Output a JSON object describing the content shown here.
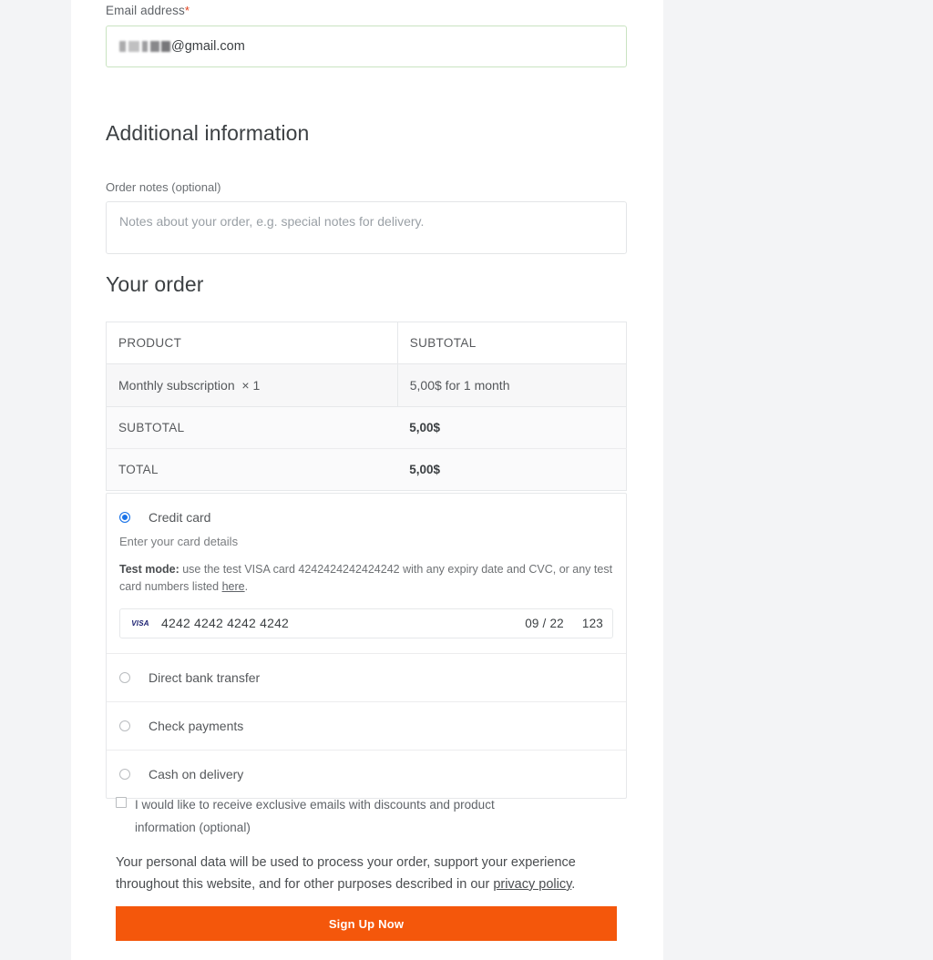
{
  "email_section": {
    "label": "Email address",
    "required_marker": "*",
    "value_redacted_suffix": "@gmail.com"
  },
  "additional_information": {
    "heading": "Additional information",
    "order_notes_label": "Order notes (optional)",
    "order_notes_placeholder": "Notes about your order, e.g. special notes for delivery.",
    "order_notes_value": ""
  },
  "your_order": {
    "heading": "Your order",
    "columns": [
      "PRODUCT",
      "SUBTOTAL"
    ],
    "rows": [
      {
        "product": "Monthly subscription",
        "qty": "× 1",
        "subtotal": "5,00$ for 1 month"
      }
    ],
    "summary": [
      {
        "label": "SUBTOTAL",
        "amount": "5,00$"
      },
      {
        "label": "TOTAL",
        "amount": "5,00$"
      }
    ]
  },
  "payment": {
    "methods": [
      {
        "label": "Credit card",
        "selected": true
      },
      {
        "label": "Direct bank transfer",
        "selected": false
      },
      {
        "label": "Check payments",
        "selected": false
      },
      {
        "label": "Cash on delivery",
        "selected": false
      }
    ],
    "credit_card": {
      "subtitle": "Enter your card details",
      "test_mode_label": "Test mode:",
      "test_mode_text_1": " use the test VISA card 4242424242424242 with any expiry date and CVC, or any test card numbers listed ",
      "test_mode_link": "here",
      "test_mode_text_2": ".",
      "brand_icon": "visa-logo",
      "card_number": "4242 4242 4242 4242",
      "expiry": "09 / 22",
      "cvc": "123"
    }
  },
  "consent": {
    "marketing_optin": "I would like to receive exclusive emails with discounts and product information (optional)",
    "checked": false,
    "privacy_text_1": "Your personal data will be used to process your order, support your experience throughout this website, and for other purposes described in our ",
    "privacy_link": "privacy policy",
    "privacy_text_2": "."
  },
  "submit": {
    "label": "Sign Up Now",
    "color": "#f4570b"
  }
}
